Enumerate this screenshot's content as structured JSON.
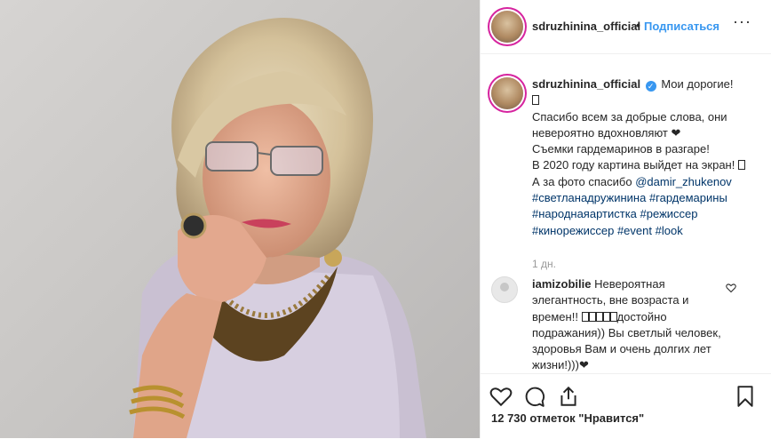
{
  "post": {
    "username": "sdruzhinina_official",
    "header_dot": "•",
    "follow_label": "Подписаться",
    "more_label": "···"
  },
  "caption": {
    "username": "sdruzhinina_official",
    "verified": "✓",
    "lines": [
      "Мои дорогие!",
      "Спасибо всем за добрые слова, они невероятно вдохновляют ❤",
      "Съемки гардемаринов в разгаре!",
      "В 2020 году картина выйдет на экран!",
      "А за фото спасибо"
    ],
    "mention": "@damir_zhukenov",
    "hashtags": [
      "#светланадружинина",
      "#гардемарины",
      "#народнаяартистка",
      "#режиссер",
      "#кинорежиссер",
      "#event",
      "#look"
    ],
    "time": "1 дн."
  },
  "comment": {
    "username": "iamizobilie",
    "text": "Невероятная элегантность, вне возраста и времен!!",
    "text2": "достойно подражания)) Вы светлый человек, здоровья Вам и очень долгих лет жизни!)))❤"
  },
  "likes": "12 730 отметок \"Нравится\"",
  "icons": [
    "heart-icon",
    "comment-icon",
    "share-icon",
    "bookmark-icon",
    "more-icon"
  ],
  "colors": {
    "link": "#3897f0",
    "hashtag": "#003569",
    "meta": "#999999"
  }
}
